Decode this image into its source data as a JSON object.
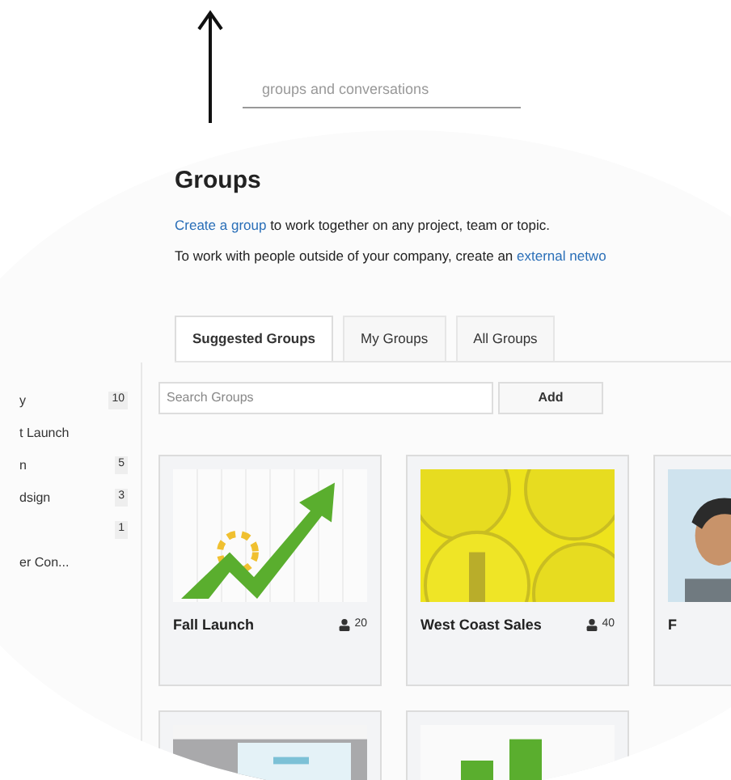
{
  "header": {
    "search": {
      "placeholder": "groups and conversations"
    }
  },
  "page": {
    "title": "Groups",
    "intro_link_1": "Create a group",
    "intro_rest_1": " to work together on any project, team or topic.",
    "intro_2": "To work with people outside of your company, create an ",
    "intro_link_2": "external netwo"
  },
  "tabs": [
    {
      "label": "Suggested Groups",
      "selected": true
    },
    {
      "label": "My Groups",
      "selected": false
    },
    {
      "label": "All Groups",
      "selected": false
    }
  ],
  "sidebar": {
    "items": [
      {
        "label": "y",
        "count": "10"
      },
      {
        "label": "t Launch"
      },
      {
        "label": "n",
        "count": "5"
      },
      {
        "label": "dsign",
        "count": "3"
      },
      {
        "count": "1"
      },
      {
        "label": "er Con..."
      }
    ]
  },
  "group_search": {
    "placeholder": "Search Groups",
    "button": "Add"
  },
  "cards": [
    {
      "name": "Fall Launch",
      "members": "20",
      "kind": "growth"
    },
    {
      "name": "West Coast Sales",
      "members": "40",
      "kind": "coins"
    },
    {
      "name": "F",
      "kind": "person"
    },
    {
      "kind": "screen"
    },
    {
      "kind": "bars"
    }
  ]
}
